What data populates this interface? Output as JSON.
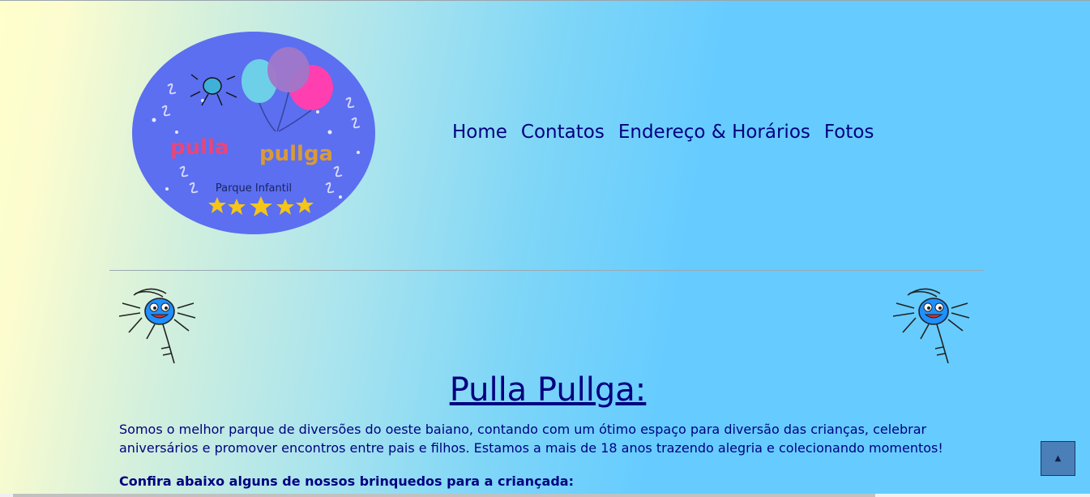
{
  "logo": {
    "brand_line1": "pulla",
    "brand_line2": "pullga",
    "tagline": "Parque Infantil"
  },
  "nav": {
    "items": [
      "Home",
      "Contatos",
      "Endereço & Horários",
      "Fotos"
    ]
  },
  "main": {
    "title": "Pulla Pullga:",
    "description": "Somos o melhor parque de diversões do oeste baiano, contando com um ótimo espaço para diversão das crianças, celebrar aniversários e promover encontros entre pais e filhos. Estamos a mais de 18 anos trazendo alegria e colecionando momentos!",
    "subheading": "Confira abaixo alguns de nossos brinquedos para a criançada:"
  },
  "back_to_top": {
    "icon": "triangle-up-icon",
    "glyph": "▲"
  },
  "colors": {
    "text": "#000080",
    "logo_circle": "#5b6ff0",
    "sky_blue": "#66ccff",
    "cream": "#ffffcc"
  }
}
